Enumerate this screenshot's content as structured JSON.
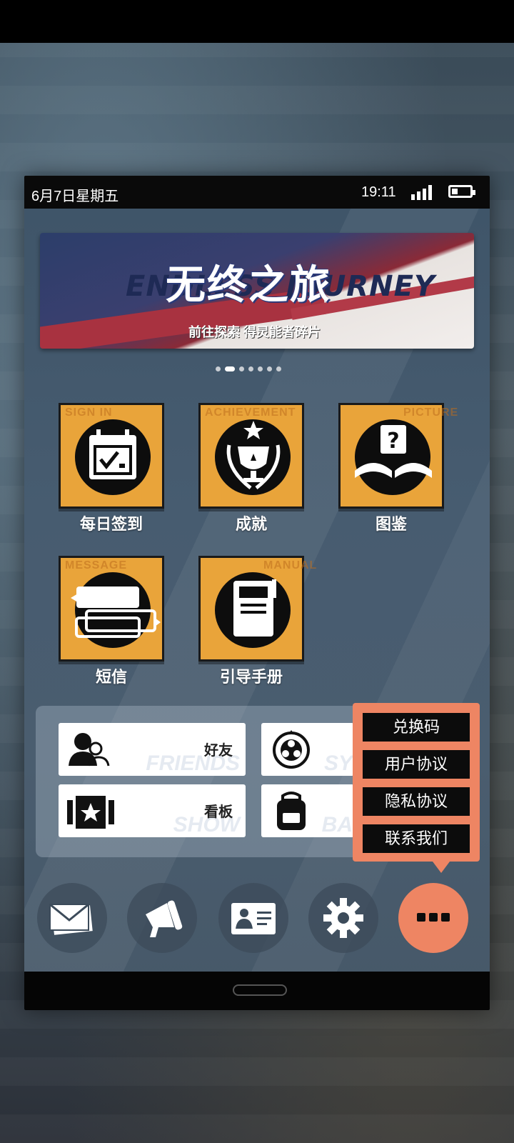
{
  "status": {
    "date": "6月7日星期五",
    "time": "19:11"
  },
  "banner": {
    "title_cn": "无终之旅",
    "title_en": "ENDLESS JOURNEY",
    "subtitle": "前往探索 得灵能者碎片"
  },
  "carousel": {
    "count": 7,
    "active_index": 1
  },
  "tiles": [
    {
      "label": "每日签到",
      "watermark": "SIGN IN",
      "icon": "calendar-check-icon"
    },
    {
      "label": "成就",
      "watermark": "ACHIEVEMENT",
      "icon": "trophy-laurel-icon"
    },
    {
      "label": "图鉴",
      "watermark": "PICTURE",
      "icon": "book-question-icon"
    },
    {
      "label": "短信",
      "watermark": "MESSAGE",
      "icon": "chat-bubble-icon"
    },
    {
      "label": "引导手册",
      "watermark": "MANUAL",
      "icon": "manual-book-icon"
    }
  ],
  "panel": {
    "friends": {
      "label": "好友",
      "ghost": "FRIENDS",
      "icon": "friends-icon"
    },
    "board": {
      "label": "看板",
      "ghost": "SHOW",
      "icon": "star-card-icon"
    },
    "sys_ghost": "SY",
    "bag_ghost": "BA"
  },
  "popup_menu": [
    "兑换码",
    "用户协议",
    "隐私协议",
    "联系我们"
  ],
  "bottom_buttons": [
    "mail-icon",
    "megaphone-icon",
    "id-card-icon",
    "gear-icon",
    "more-icon"
  ],
  "colors": {
    "tile": "#e9a43a",
    "accent": "#ee8563",
    "panel": "#b4c3d2"
  }
}
